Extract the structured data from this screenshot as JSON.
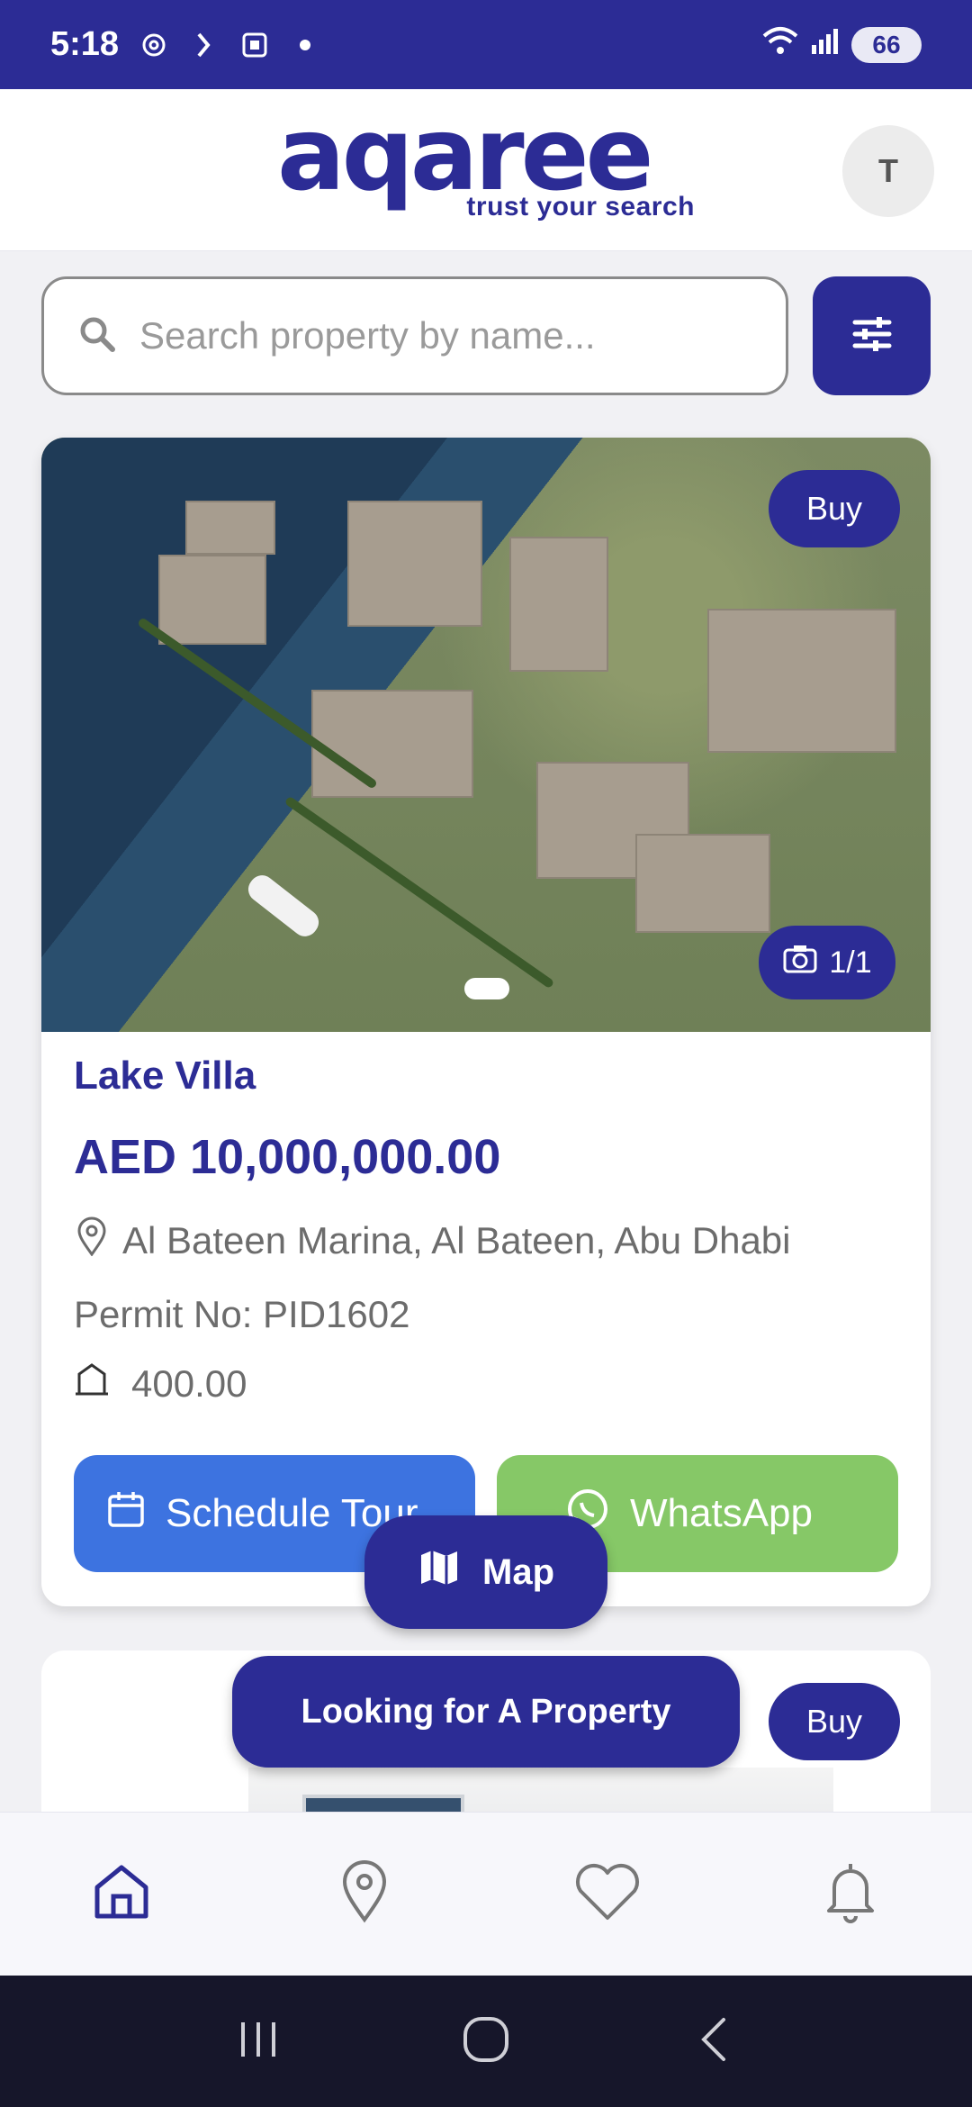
{
  "status_bar": {
    "time": "5:18",
    "battery": "66"
  },
  "header": {
    "logo_text": "aqaree",
    "logo_tagline": "trust your search",
    "avatar_initial": "T"
  },
  "search": {
    "placeholder": "Search property by name..."
  },
  "listing": {
    "badge": "Buy",
    "photo_count": "1/1",
    "title": "Lake Villa",
    "price": "AED 10,000,000.00",
    "location": "Al Bateen Marina, Al Bateen, Abu Dhabi",
    "permit": "Permit No: PID1602",
    "area": "400.00",
    "schedule_label": "Schedule Tour",
    "whatsapp_label": "WhatsApp"
  },
  "map_button": {
    "label": "Map"
  },
  "listing2": {
    "badge": "Buy"
  },
  "looking_button": {
    "label": "Looking for A Property"
  },
  "bottom_nav": {
    "items": [
      "home-icon",
      "location-icon",
      "heart-icon",
      "bell-icon"
    ],
    "active": "home-icon"
  },
  "colors": {
    "brand": "#2c2c95",
    "schedule": "#3d73e0",
    "whatsapp": "#86c867"
  }
}
